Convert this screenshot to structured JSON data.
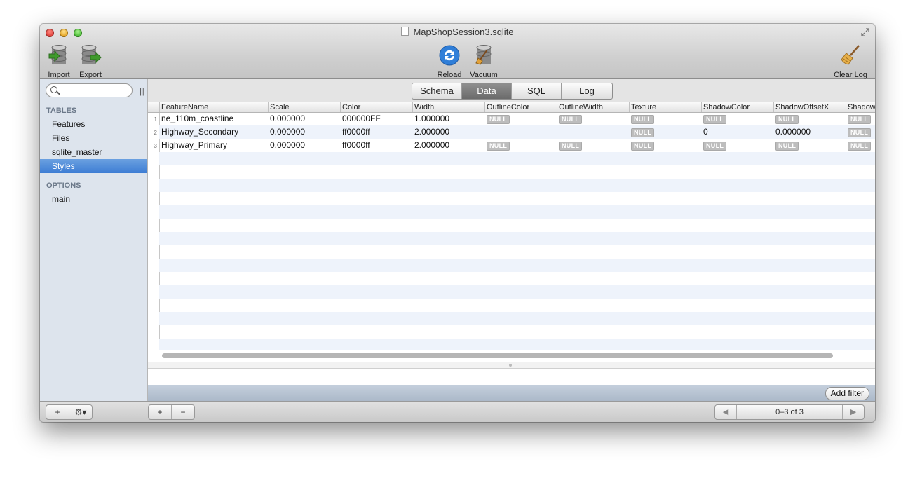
{
  "window": {
    "title": "MapShopSession3.sqlite"
  },
  "toolbar": {
    "import_label": "Import",
    "export_label": "Export",
    "reload_label": "Reload",
    "vacuum_label": "Vacuum",
    "clear_log_label": "Clear Log"
  },
  "sidebar": {
    "search_placeholder": "",
    "tables_heading": "TABLES",
    "tables": [
      "Features",
      "Files",
      "sqlite_master",
      "Styles"
    ],
    "selected_table": "Styles",
    "options_heading": "OPTIONS",
    "options": [
      "main"
    ]
  },
  "tabs": [
    "Schema",
    "Data",
    "SQL",
    "Log"
  ],
  "active_tab": "Data",
  "grid": {
    "columns": [
      "FeatureName",
      "Scale",
      "Color",
      "Width",
      "OutlineColor",
      "OutlineWidth",
      "Texture",
      "ShadowColor",
      "ShadowOffsetX",
      "Shadow"
    ],
    "null_label": "NULL",
    "rows": [
      {
        "num": "1",
        "cells": [
          "ne_110m_coastline",
          "0.000000",
          "000000FF",
          "1.000000",
          null,
          null,
          null,
          null,
          null,
          null
        ]
      },
      {
        "num": "2",
        "cells": [
          "Highway_Secondary",
          "0.000000",
          "ff0000ff",
          "2.000000",
          "",
          "",
          null,
          "0",
          "0.000000",
          null
        ]
      },
      {
        "num": "3",
        "cells": [
          "Highway_Primary",
          "0.000000",
          "ff0000ff",
          "2.000000",
          null,
          null,
          null,
          null,
          null,
          null
        ]
      }
    ]
  },
  "filter": {
    "add_filter_label": "Add filter"
  },
  "bottom": {
    "add_symbol": "+",
    "gear_symbol": "⚙▾",
    "remove_symbol": "−",
    "pager_text": "0–3 of 3",
    "prev_symbol": "◀",
    "next_symbol": "▶"
  },
  "colors": {
    "selection": "#3d7dd4",
    "sidebar_bg": "#dde4ed",
    "row_stripe": "#eef3fb",
    "null_badge": "#bdbdbd"
  }
}
